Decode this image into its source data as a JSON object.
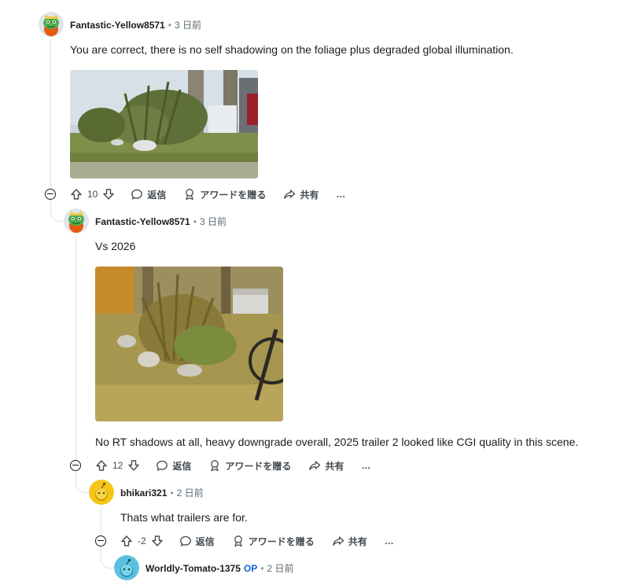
{
  "actions": {
    "reply": "返信",
    "award": "アワードを贈る",
    "share": "共有",
    "more": "…"
  },
  "comments": [
    {
      "author": "Fantastic-Yellow8571",
      "time": "3 日前",
      "text": "You are correct, there is no self shadowing on the foliage plus degraded global illumination.",
      "score": "10",
      "image": "foliage-screenshot-2013"
    },
    {
      "author": "Fantastic-Yellow8571",
      "time": "3 日前",
      "text_top": "Vs 2026",
      "text": "No RT shadows at all, heavy downgrade overall, 2025 trailer 2 looked like CGI quality in this scene.",
      "score": "12",
      "image": "foliage-screenshot-2026"
    },
    {
      "author": "bhikari321",
      "time": "2 日前",
      "text": "Thats what trailers are for.",
      "score": "-2"
    },
    {
      "author": "Worldly-Tomato-1375",
      "badge": "OP",
      "time": "2 日前"
    }
  ],
  "colors": {
    "op_badge": "#0a66d8",
    "thread_line": "#e0e3e6",
    "meta_text": "#5c6b73"
  }
}
